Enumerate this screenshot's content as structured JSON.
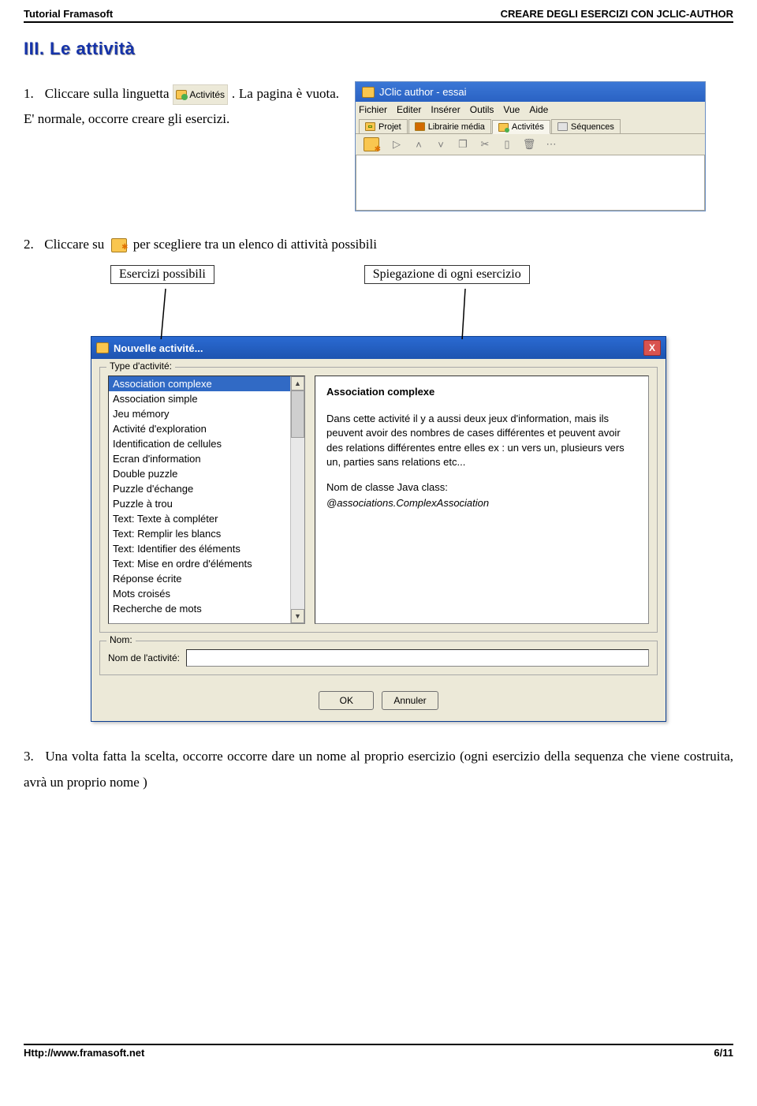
{
  "header": {
    "left": "Tutorial Framasoft",
    "right": "CREARE DEGLI ESERCIZI CON JCLIC-AUTHOR"
  },
  "section_title": "III. Le attività",
  "step1": {
    "num": "1.",
    "before": "Cliccare sulla linguetta",
    "icon_label": "Activités",
    "after": ". La pagina è vuota. E' normale, occorre creare gli esercizi."
  },
  "jclic": {
    "title": "JClic author - essai",
    "menus": [
      "Fichier",
      "Editer",
      "Insérer",
      "Outils",
      "Vue",
      "Aide"
    ],
    "tabs": [
      {
        "label": "Projet"
      },
      {
        "label": "Librairie média"
      },
      {
        "label": "Activités"
      },
      {
        "label": "Séquences"
      }
    ]
  },
  "step2": {
    "num": "2.",
    "before": "Cliccare su",
    "after": "per scegliere tra un elenco di attività possibili"
  },
  "callout_left": "Esercizi possibili",
  "callout_right": "Spiegazione di ogni esercizio",
  "dialog": {
    "title": "Nouvelle activité...",
    "close": "X",
    "group1_legend": "Type d'activité:",
    "list": [
      "Association complexe",
      "Association simple",
      "Jeu mémory",
      "Activité d'exploration",
      "Identification de cellules",
      "Ecran d'information",
      "Double puzzle",
      "Puzzle d'échange",
      "Puzzle à trou",
      "Text: Texte à compléter",
      "Text: Remplir les blancs",
      "Text: Identifier des éléments",
      "Text: Mise en ordre d'éléments",
      "Réponse écrite",
      "Mots croisés",
      "Recherche de mots"
    ],
    "desc_title": "Association complexe",
    "desc_p1": "Dans cette activité il y a aussi deux jeux d'information, mais ils peuvent avoir des nombres de cases différentes et peuvent avoir des relations différentes entre elles ex : un vers un, plusieurs vers un, parties sans relations etc...",
    "desc_p2": "Nom de classe Java class:",
    "desc_p3": "@associations.ComplexAssociation",
    "group2_legend": "Nom:",
    "nom_label": "Nom de l'activité:",
    "ok": "OK",
    "cancel": "Annuler"
  },
  "step3": {
    "num": "3.",
    "text": "Una volta fatta la scelta, occorre occorre dare un nome al proprio esercizio (ogni esercizio della sequenza che viene costruita, avrà un proprio nome )"
  },
  "footer": {
    "left": "Http://www.framasoft.net",
    "right": "6/11"
  }
}
